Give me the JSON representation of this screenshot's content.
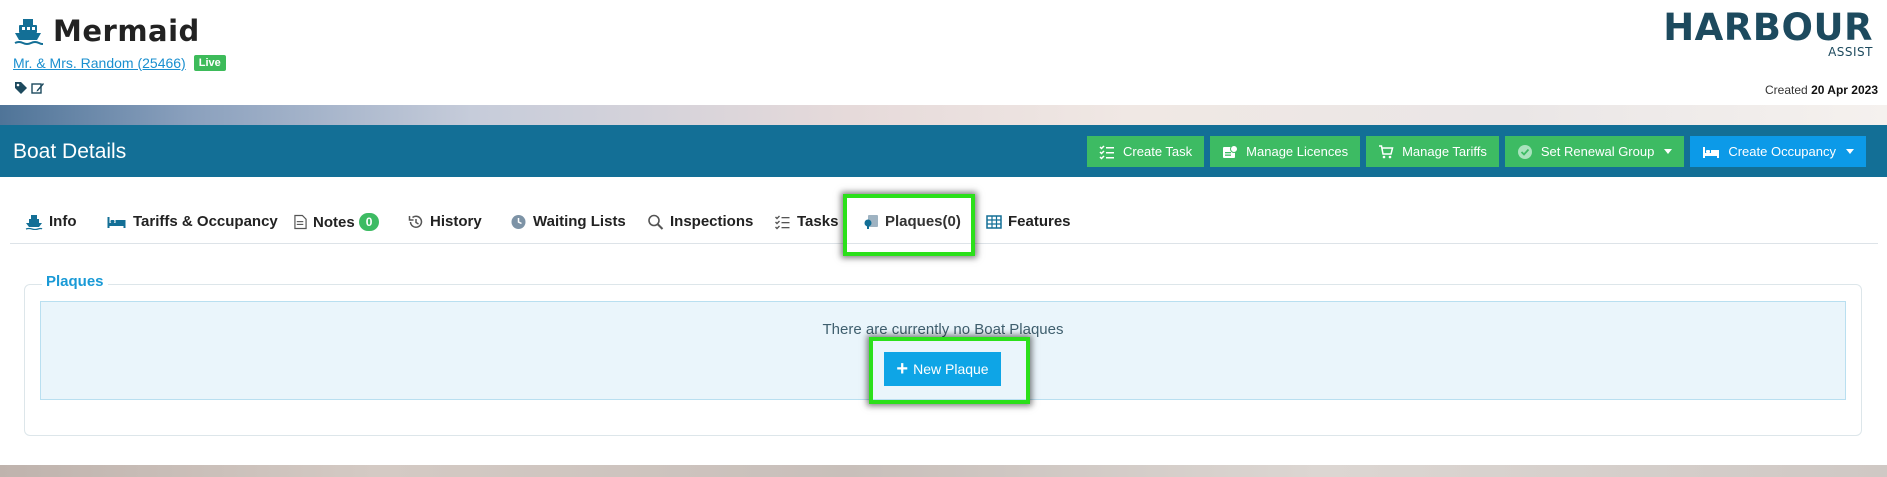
{
  "boat": {
    "name": "Mermaid",
    "owner_link": "Mr. & Mrs. Random (25466)",
    "status_badge": "Live",
    "created_label": "Created",
    "created_date": "20 Apr 2023"
  },
  "logo": {
    "main": "HARBOUR",
    "sub": "ASSIST"
  },
  "toolbar": {
    "title": "Boat Details",
    "create_task": "Create Task",
    "manage_licences": "Manage Licences",
    "manage_tariffs": "Manage Tariffs",
    "set_renewal_group": "Set Renewal Group",
    "create_occupancy": "Create Occupancy"
  },
  "tabs": {
    "info": "Info",
    "tariffs": "Tariffs & Occupancy",
    "notes": "Notes",
    "notes_count": "0",
    "history": "History",
    "waiting_lists": "Waiting Lists",
    "inspections": "Inspections",
    "tasks": "Tasks",
    "plaques": "Plaques(0)",
    "features": "Features"
  },
  "plaques": {
    "legend": "Plaques",
    "empty_message": "There are currently no Boat Plaques",
    "new_button": "New Plaque"
  },
  "colors": {
    "bar_blue": "#136f96",
    "action_green": "#3dbb63",
    "action_blue": "#0c9ae8",
    "highlight": "#2be01a"
  },
  "icons": [
    "ship-icon",
    "tag-icon",
    "edit-icon",
    "checklist-icon",
    "licence-icon",
    "cart-icon",
    "check-circle-icon",
    "bed-icon",
    "note-icon",
    "history-icon",
    "clock-icon",
    "search-icon",
    "plaque-icon",
    "table-icon",
    "plus-icon"
  ]
}
